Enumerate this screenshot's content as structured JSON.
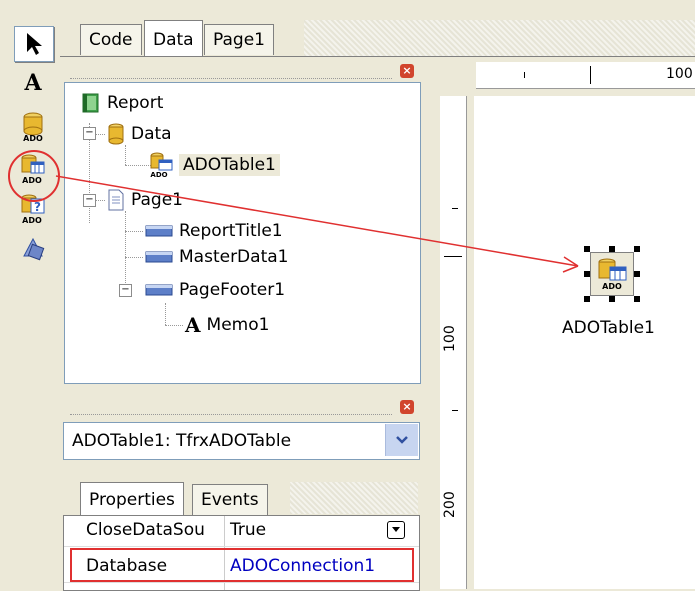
{
  "tabs": [
    "Code",
    "Data",
    "Page1"
  ],
  "active_tab": "Data",
  "palette": {
    "tools": [
      "arrow-pointer-icon",
      "text-tool-icon",
      "ado-database-icon",
      "ado-table-icon",
      "ado-query-icon",
      "ado-stored-proc-icon"
    ],
    "highlighted_tool": "ado-table-icon"
  },
  "tree": {
    "nodes": [
      {
        "label": "Report",
        "icon": "report-icon"
      },
      {
        "label": "Data",
        "icon": "database-icon"
      },
      {
        "label": "ADOTable1",
        "icon": "ado-table-icon"
      },
      {
        "label": "Page1",
        "icon": "page-icon"
      },
      {
        "label": "ReportTitle1",
        "icon": "band-icon"
      },
      {
        "label": "MasterData1",
        "icon": "band-icon"
      },
      {
        "label": "PageFooter1",
        "icon": "band-icon"
      },
      {
        "label": "Memo1",
        "icon": "memo-icon"
      }
    ]
  },
  "object_selector": {
    "value": "ADOTable1: TfrxADOTable"
  },
  "inspector": {
    "tabs": [
      "Properties",
      "Events"
    ],
    "rows": [
      {
        "name": "CloseDataSou",
        "value": "True"
      },
      {
        "name": "Database",
        "value": "ADOConnection1"
      }
    ]
  },
  "ruler": {
    "top_label": "100",
    "left_labels": [
      "100",
      "200"
    ]
  },
  "canvas": {
    "component_label": "ADOTable1",
    "ado_text": "ADO"
  },
  "colors": {
    "highlight_red": "#e03030",
    "link_blue": "#0000c0"
  }
}
